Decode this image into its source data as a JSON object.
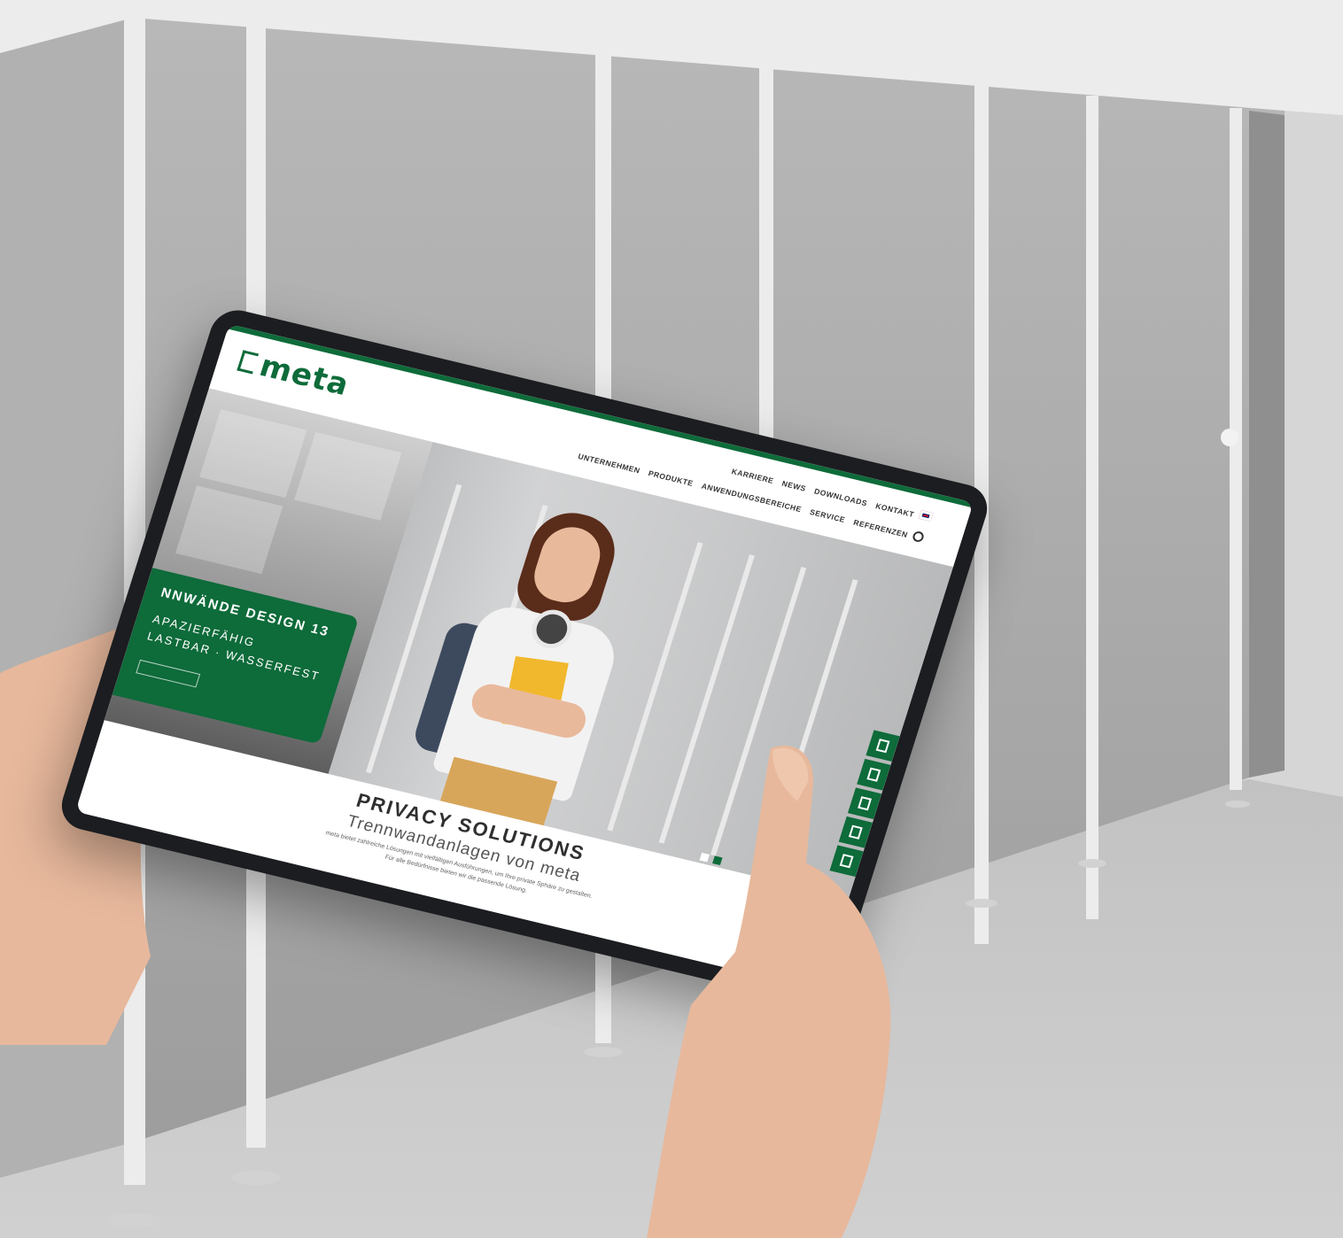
{
  "colors": {
    "brand_green": "#0e6b3a",
    "tablet_frame": "#1b1d20",
    "wall_grey": "#a8a8a8"
  },
  "scene": {
    "subject": "Hands holding a tablet in front of grey toilet partition cubicles"
  },
  "website": {
    "logo": {
      "text": "meta",
      "icon": "meta-logo-icon"
    },
    "nav_top": [
      "KARRIERE",
      "NEWS",
      "DOWNLOADS",
      "KONTAKT"
    ],
    "nav_main": [
      "UNTERNEHMEN",
      "PRODUKTE",
      "ANWENDUNGSBEREICHE",
      "SERVICE",
      "REFERENZEN"
    ],
    "language_icon": "uk-flag-icon",
    "search_icon": "search-icon",
    "promo": {
      "title": "NNWÄNDE DESIGN 13",
      "line1": "APAZIERFÄHIG",
      "line2": "LASTBAR · WASSERFEST",
      "button": ""
    },
    "side_icons": [
      "door-icon",
      "panel-icon",
      "handle-icon",
      "bench-icon",
      "locker-icon"
    ],
    "content": {
      "title": "PRIVACY SOLUTIONS",
      "subtitle": "Trennwandanlagen von meta",
      "paragraph1": "meta bietet zahlreiche Lösungen mit vielfältigen Ausführungen, um Ihre private Sphäre zu gestalten.",
      "paragraph2": "Für alle Bedürfnisse bieten wir die passende Lösung."
    },
    "slider": {
      "slides": 2,
      "active": 2
    }
  }
}
